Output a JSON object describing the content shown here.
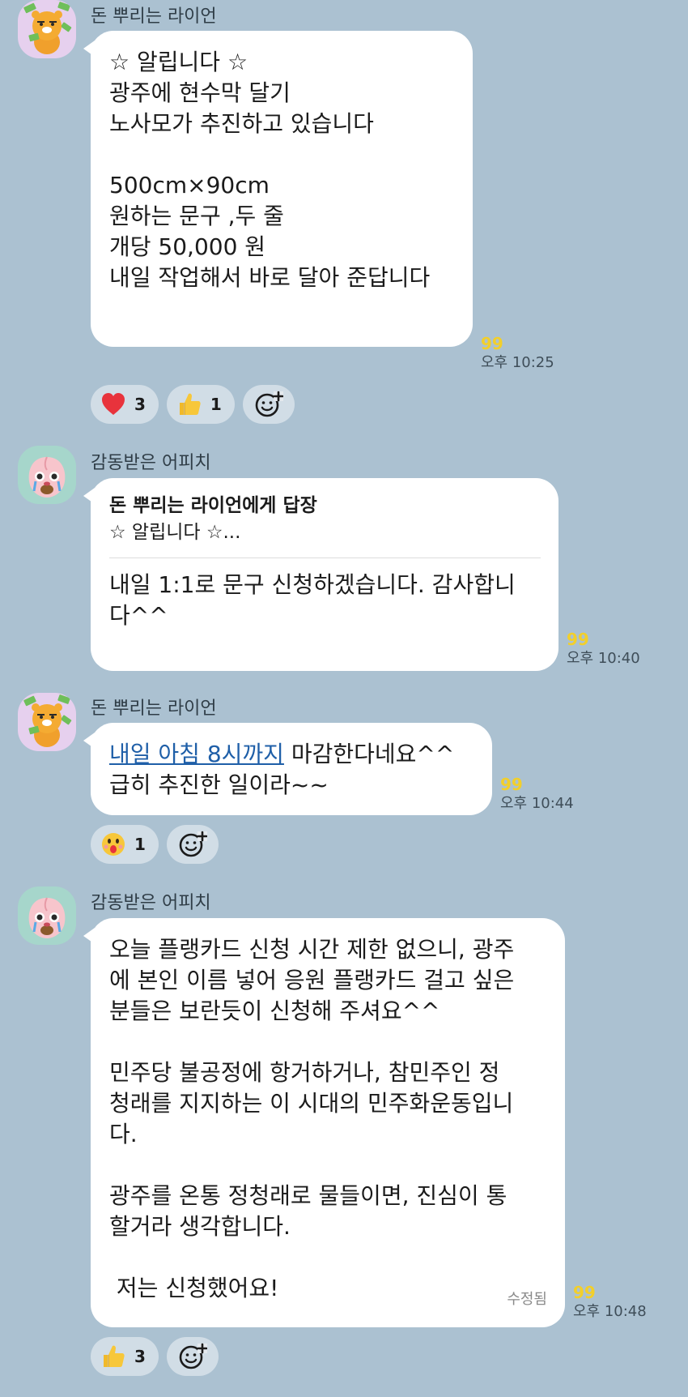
{
  "messages": [
    {
      "sender": "돈 뿌리는 라이언",
      "avatar": "lion-avatar",
      "lines": [
        "☆ 알립니다 ☆",
        "광주에 현수막 달기",
        "노사모가 추진하고 있습니다",
        "",
        "500cm×90cm",
        "원하는 문구 ,두 줄",
        "개당 50,000 원",
        "내일 작업해서 바로 달아 준답니다"
      ],
      "unread": "99",
      "time": "오후 10:25",
      "reactions": [
        {
          "icon": "heart-icon",
          "count": "3"
        },
        {
          "icon": "thumbs-up-icon",
          "count": "1"
        }
      ]
    },
    {
      "sender": "감동받은 어피치",
      "avatar": "apeach-avatar",
      "reply_to": "돈 뿌리는 라이언에게 답장",
      "reply_quote": "☆ 알립니다 ☆...",
      "lines": [
        "내일 1:1로 문구 신청하겠습니다. 감사합니",
        "다^^"
      ],
      "unread": "99",
      "time": "오후 10:40"
    },
    {
      "sender": "돈 뿌리는 라이언",
      "avatar": "lion-avatar",
      "link_text": "내일 아침 8시까지",
      "line1_rest": " 마감한다네요^^",
      "line2": "급히 추진한 일이라~~",
      "unread": "99",
      "time": "오후 10:44",
      "reactions": [
        {
          "icon": "surprised-face-icon",
          "count": "1"
        }
      ]
    },
    {
      "sender": "감동받은 어피치",
      "avatar": "apeach-avatar",
      "lines": [
        "오늘 플랭카드 신청 시간 제한 없으니, 광주",
        "에 본인 이름 넣어 응원 플랭카드 걸고 싶은",
        "분들은 보란듯이 신청해 주셔요^^",
        "",
        "민주당 불공정에 항거하거나, 참민주인 정",
        "청래를 지지하는 이 시대의 민주화운동입니",
        "다.",
        "",
        "광주를 온통 정청래로 물들이면, 진심이 통",
        "할거라 생각합니다.",
        "",
        " 저는 신청했어요!"
      ],
      "edited": "수정됨",
      "unread": "99",
      "time": "오후 10:48",
      "reactions": [
        {
          "icon": "thumbs-up-icon",
          "count": "3"
        }
      ]
    }
  ],
  "colors": {
    "background": "#abc1d1",
    "bubble": "#ffffff",
    "unread": "#f2cf2b",
    "link": "#1f5fa8"
  }
}
